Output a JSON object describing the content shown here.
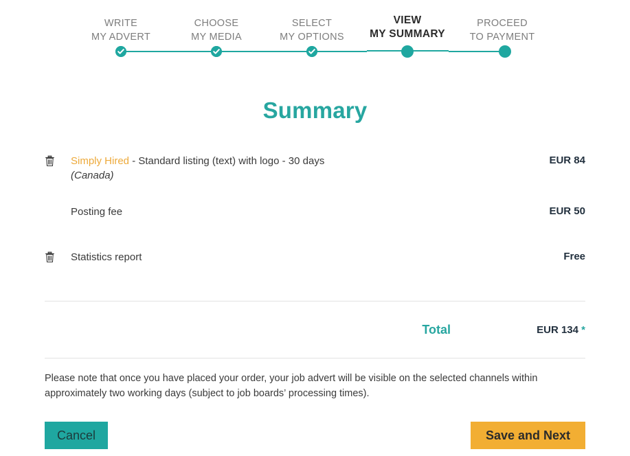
{
  "stepper": {
    "steps": [
      {
        "line1": "WRITE",
        "line2": "MY ADVERT",
        "state": "completed"
      },
      {
        "line1": "CHOOSE",
        "line2": "MY MEDIA",
        "state": "completed"
      },
      {
        "line1": "SELECT",
        "line2": "MY OPTIONS",
        "state": "completed"
      },
      {
        "line1": "VIEW",
        "line2": "MY SUMMARY",
        "state": "active"
      },
      {
        "line1": "PROCEED",
        "line2": "TO PAYMENT",
        "state": "upcoming"
      }
    ]
  },
  "page": {
    "title": "Summary"
  },
  "summary": {
    "items": [
      {
        "brand": "Simply Hired",
        "description": " - Standard listing (text) with logo - 30 days",
        "sub": "(Canada)",
        "price": "EUR 84",
        "removable": true
      },
      {
        "brand": "",
        "description": "Posting fee",
        "sub": "",
        "price": "EUR 50",
        "removable": false
      },
      {
        "brand": "",
        "description": "Statistics report",
        "sub": "",
        "price": "Free",
        "removable": true
      }
    ],
    "total_label": "Total",
    "total_value": "EUR 134",
    "total_asterisk": "*"
  },
  "note": {
    "text": "Please note that once you have placed your order, your job advert will be visible on the selected channels within approximately two working days (subject to job boards’ processing times)."
  },
  "actions": {
    "cancel_label": "Cancel",
    "next_label": "Save and Next"
  },
  "colors": {
    "teal": "#1fa7a0",
    "teal_text": "#27a6a0",
    "orange": "#f2ae33",
    "brand_orange": "#eda93a",
    "price_dark": "#22303e",
    "label_gray": "#7d7d7d",
    "divider": "#e2e2e2"
  }
}
